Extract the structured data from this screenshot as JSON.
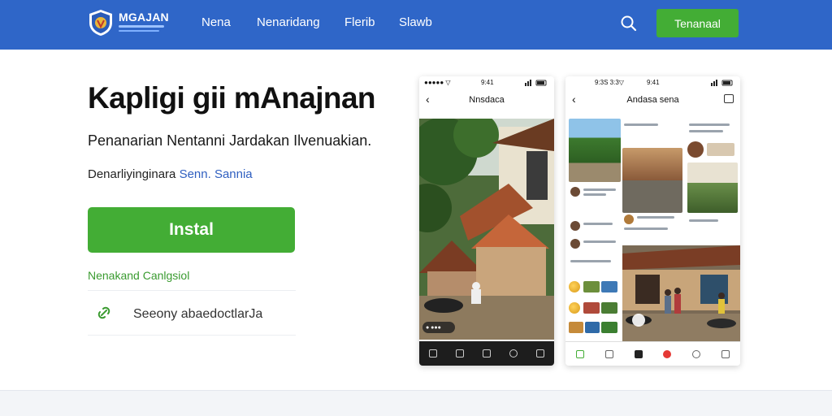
{
  "brand": {
    "name": "MGAJAN",
    "colors": {
      "primary": "#2f66c8",
      "accent": "#43ad35"
    }
  },
  "nav": {
    "items": [
      {
        "label": "Nena"
      },
      {
        "label": "Nenaridang"
      },
      {
        "label": "Flerib"
      },
      {
        "label": "Slawb"
      }
    ],
    "search_icon": "search-icon",
    "cta_label": "Tenanaal"
  },
  "hero": {
    "title": "Kapligi gii mAnajnan",
    "subtitle": "Penanarian Nentanni Jardakan Ilvenuakian.",
    "rating_prefix": "Denarliyinginara",
    "rating_highlight": "Senn. Sannia",
    "install_label": "Instal",
    "green_link": "Nenakand Canlgsiol",
    "feature_text": "Seeony abaedoctlarJa",
    "feature_icon": "link-icon"
  },
  "phone1": {
    "time": "9:41",
    "status_left": "●●●●● ▽",
    "title": "Nnsdaca",
    "overlay_label": "● ●●●"
  },
  "phone2": {
    "time": "9:41",
    "status_left": "9:3S 3:3▽",
    "title": "Andasa sena"
  }
}
